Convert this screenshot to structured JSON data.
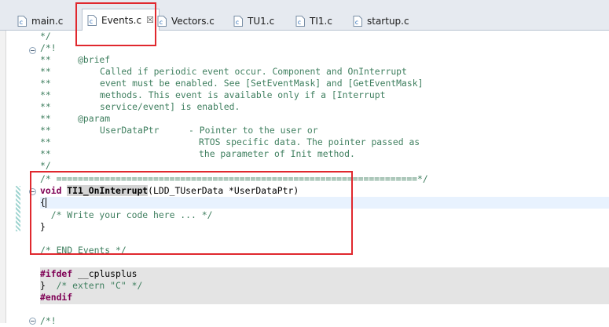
{
  "tabs": [
    {
      "label": "main.c",
      "icon": "c-file-icon"
    },
    {
      "label": "Events.c",
      "icon": "c-file-icon",
      "active": true,
      "close": "☒"
    },
    {
      "label": "Vectors.c",
      "icon": "c-file-icon"
    },
    {
      "label": "TU1.c",
      "icon": "c-file-icon"
    },
    {
      "label": "TI1.c",
      "icon": "c-file-icon"
    },
    {
      "label": "startup.c",
      "icon": "c-file-icon"
    }
  ],
  "code": {
    "l0": "*/",
    "l1": "/*!",
    "l2a": "**",
    "l2b": "@brief",
    "l3a": "**",
    "l3b": "Called if periodic event occur. Component and OnInterrupt",
    "l4a": "**",
    "l4b": "event must be enabled. See [SetEventMask] and [GetEventMask]",
    "l5a": "**",
    "l5b": "methods. This event is available only if a [Interrupt",
    "l6a": "**",
    "l6b": "service/event] is enabled.",
    "l7a": "**",
    "l7b": "@param",
    "l8a": "**",
    "l8b": "UserDataPtr",
    "l8c": "- Pointer to the user or",
    "l9a": "**",
    "l9b": "RTOS specific data. The pointer passed as",
    "l10a": "**",
    "l10b": "the parameter of Init method.",
    "l11": "*/",
    "l12": "/* ===================================================================*/",
    "l13_kw": "void",
    "l13_fn": "TI1_OnInterrupt",
    "l13_rest": "(LDD_TUserData *UserDataPtr)",
    "l14": "{",
    "l15": "  /* Write your code here ... */",
    "l16": "}",
    "l18": "/* END Events */",
    "l20_pp": "#ifdef",
    "l20_rest": " __cplusplus",
    "l21_a": "}",
    "l21_b": "  /* extern \"C\" */",
    "l22_pp": "#endif",
    "l24": "/*!"
  }
}
